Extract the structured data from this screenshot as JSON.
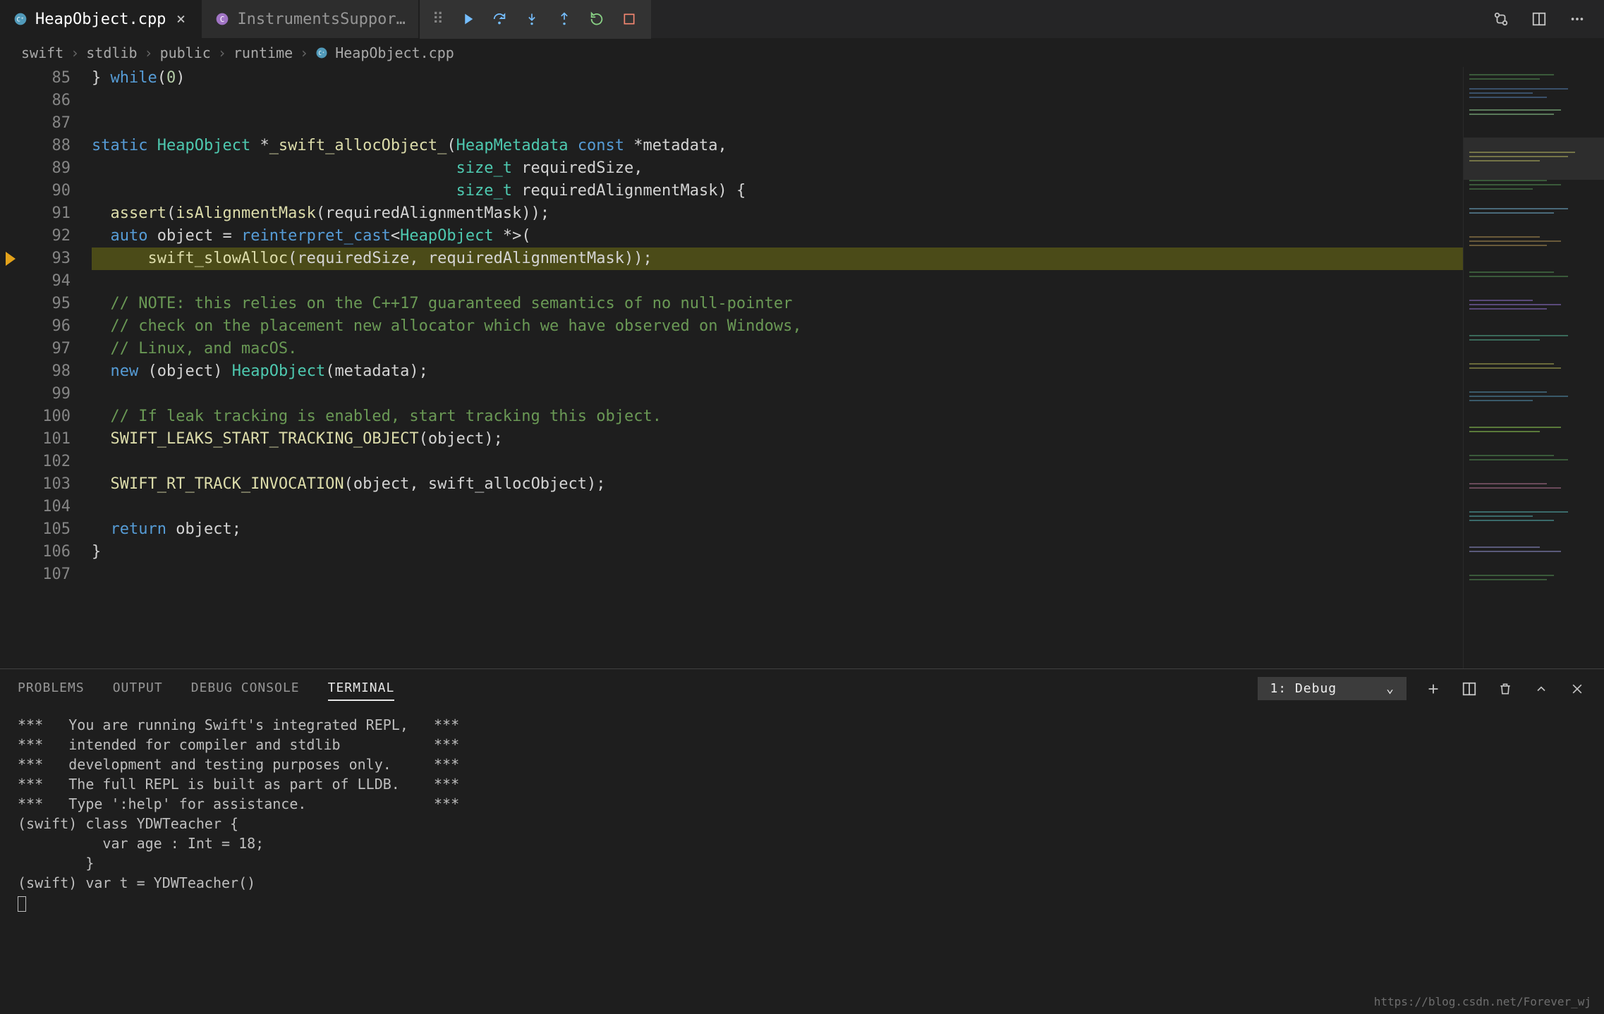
{
  "tabs": [
    {
      "label": "HeapObject.cpp",
      "lang": "C++",
      "active": true
    },
    {
      "label": "InstrumentsSuppor…",
      "lang": "C",
      "active": false
    }
  ],
  "breadcrumb": [
    "swift",
    "stdlib",
    "public",
    "runtime",
    "HeapObject.cpp"
  ],
  "debug_icons": [
    "continue",
    "step-over",
    "step-into",
    "step-out",
    "restart",
    "stop"
  ],
  "titlebar_icons": [
    "compare-changes",
    "split-editor",
    "more"
  ],
  "gutter": {
    "start": 85,
    "end": 107,
    "breakpoint": 93,
    "highlight": 93
  },
  "code_lines": [
    {
      "n": 85,
      "h": "<span class='op'>}</span> <span class='kw'>while</span><span class='op'>(</span><span class='num'>0</span><span class='op'>)</span>"
    },
    {
      "n": 86,
      "h": ""
    },
    {
      "n": 87,
      "h": ""
    },
    {
      "n": 88,
      "h": "<span class='kw'>static</span> <span class='type'>HeapObject</span> <span class='op'>*</span><span class='fn'>_swift_allocObject_</span><span class='op'>(</span><span class='type'>HeapMetadata</span> <span class='kw'>const</span> <span class='op'>*</span>metadata<span class='op'>,</span>"
    },
    {
      "n": 89,
      "h": "                                       <span class='type'>size_t</span> requiredSize<span class='op'>,</span>"
    },
    {
      "n": 90,
      "h": "                                       <span class='type'>size_t</span> requiredAlignmentMask<span class='op'>) {</span>"
    },
    {
      "n": 91,
      "h": "  <span class='fn'>assert</span><span class='op'>(</span><span class='fn'>isAlignmentMask</span><span class='op'>(</span>requiredAlignmentMask<span class='op'>));</span>"
    },
    {
      "n": 92,
      "h": "  <span class='kw'>auto</span> object <span class='op'>=</span> <span class='kw'>reinterpret_cast</span><span class='op'>&lt;</span><span class='type'>HeapObject</span> <span class='op'>*&gt;(</span>"
    },
    {
      "n": 93,
      "h": "      <span class='fn'>swift_slowAlloc</span><span class='op'>(</span>requiredSize<span class='op'>,</span> requiredAlignmentMask<span class='op'>));</span>"
    },
    {
      "n": 94,
      "h": ""
    },
    {
      "n": 95,
      "h": "  <span class='com'>// NOTE: this relies on the C++17 guaranteed semantics of no null-pointer</span>"
    },
    {
      "n": 96,
      "h": "  <span class='com'>// check on the placement new allocator which we have observed on Windows,</span>"
    },
    {
      "n": 97,
      "h": "  <span class='com'>// Linux, and macOS.</span>"
    },
    {
      "n": 98,
      "h": "  <span class='kw'>new</span> <span class='op'>(</span>object<span class='op'>)</span> <span class='type'>HeapObject</span><span class='op'>(</span>metadata<span class='op'>);</span>"
    },
    {
      "n": 99,
      "h": ""
    },
    {
      "n": 100,
      "h": "  <span class='com'>// If leak tracking is enabled, start tracking this object.</span>"
    },
    {
      "n": 101,
      "h": "  <span class='fn'>SWIFT_LEAKS_START_TRACKING_OBJECT</span><span class='op'>(</span>object<span class='op'>);</span>"
    },
    {
      "n": 102,
      "h": ""
    },
    {
      "n": 103,
      "h": "  <span class='fn'>SWIFT_RT_TRACK_INVOCATION</span><span class='op'>(</span>object<span class='op'>,</span> swift_allocObject<span class='op'>);</span>"
    },
    {
      "n": 104,
      "h": ""
    },
    {
      "n": 105,
      "h": "  <span class='kw'>return</span> object<span class='op'>;</span>"
    },
    {
      "n": 106,
      "h": "<span class='op'>}</span>"
    },
    {
      "n": 107,
      "h": ""
    }
  ],
  "panel": {
    "tabs": [
      "PROBLEMS",
      "OUTPUT",
      "DEBUG CONSOLE",
      "TERMINAL"
    ],
    "active": "TERMINAL",
    "select": "1: Debug",
    "icons": [
      "new-terminal",
      "split-terminal",
      "kill-terminal",
      "maximize-panel",
      "close-panel"
    ]
  },
  "terminal_lines": [
    "***   You are running Swift's integrated REPL,   ***",
    "***   intended for compiler and stdlib           ***",
    "***   development and testing purposes only.     ***",
    "***   The full REPL is built as part of LLDB.    ***",
    "***   Type ':help' for assistance.               ***",
    "(swift) class YDWTeacher {",
    "          var age : Int = 18;",
    "        }",
    "(swift) var t = YDWTeacher()"
  ],
  "watermark": "https://blog.csdn.net/Forever_wj"
}
